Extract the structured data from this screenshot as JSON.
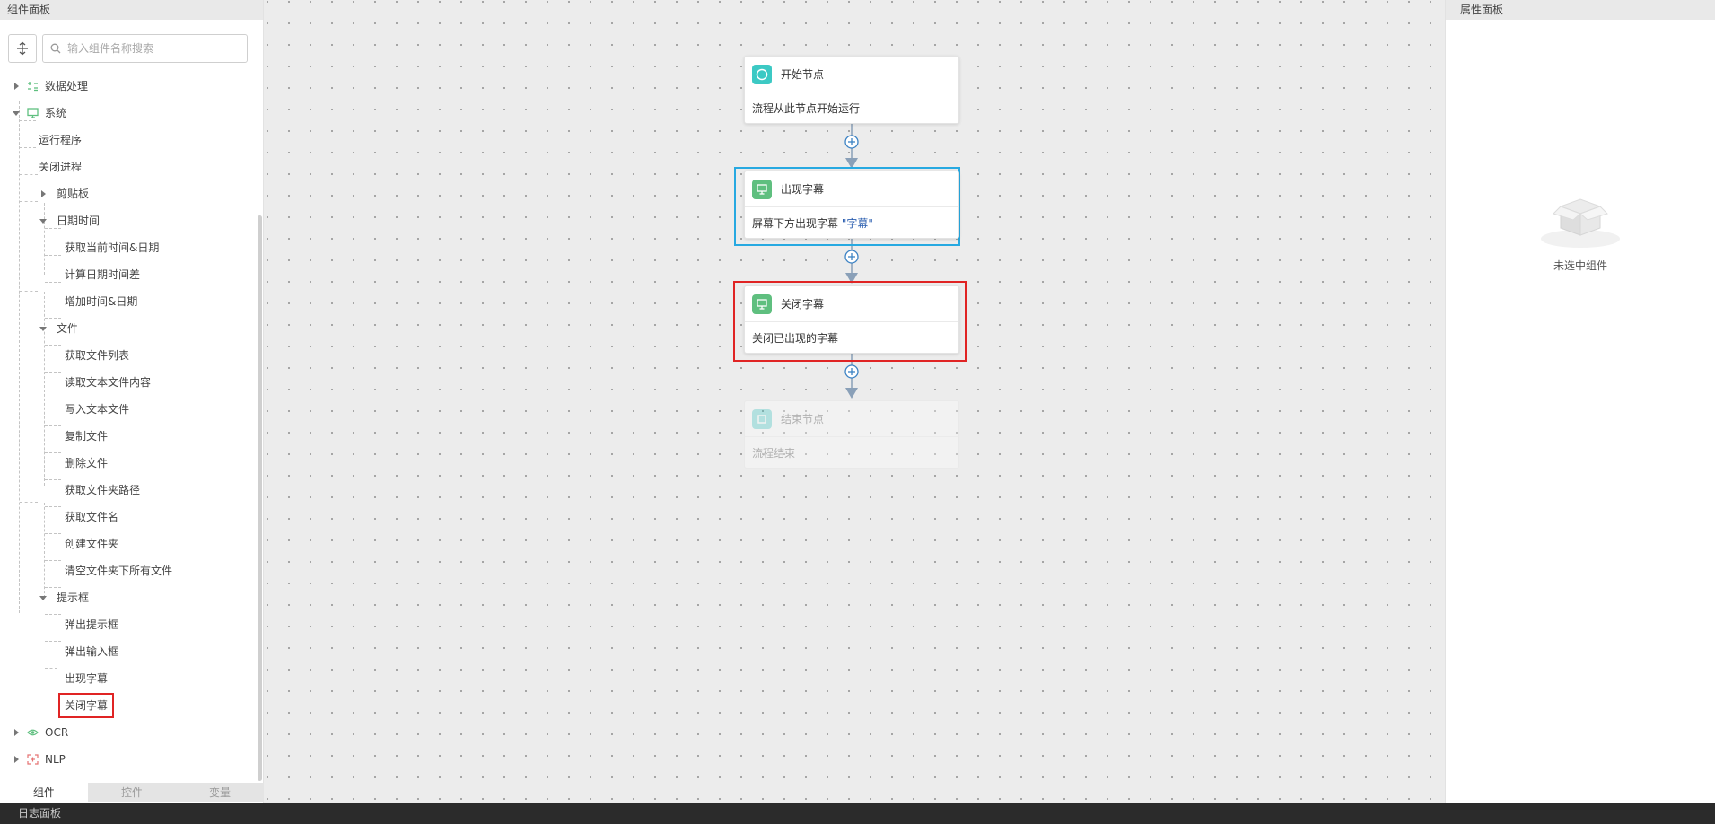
{
  "left_panel": {
    "title": "组件面板",
    "search_placeholder": "输入组件名称搜索",
    "tree": {
      "data_processing": "数据处理",
      "system": "系统",
      "run_program": "运行程序",
      "close_process": "关闭进程",
      "clipboard": "剪贴板",
      "datetime": "日期时间",
      "get_current_datetime": "获取当前时间&日期",
      "calc_date_diff": "计算日期时间差",
      "add_datetime": "增加时间&日期",
      "file": "文件",
      "get_file_list": "获取文件列表",
      "read_text_file": "读取文本文件内容",
      "write_text_file": "写入文本文件",
      "copy_file": "复制文件",
      "delete_file": "删除文件",
      "get_folder_path": "获取文件夹路径",
      "get_file_name": "获取文件名",
      "create_folder": "创建文件夹",
      "clear_folder": "清空文件夹下所有文件",
      "dialog": "提示框",
      "popup_message": "弹出提示框",
      "popup_input": "弹出输入框",
      "show_subtitle": "出现字幕",
      "close_subtitle": "关闭字幕",
      "ocr": "OCR",
      "nlp": "NLP"
    },
    "tabs": [
      "组件",
      "控件",
      "变量"
    ]
  },
  "canvas": {
    "nodes": {
      "start": {
        "title": "开始节点",
        "desc": "流程从此节点开始运行"
      },
      "show_subtitle": {
        "title": "出现字幕",
        "desc_prefix": "屏幕下方出现字幕 ",
        "desc_keyword": "\"字幕\""
      },
      "close_subtitle": {
        "title": "关闭字幕",
        "desc": "关闭已出现的字幕"
      },
      "end": {
        "title": "结束节点",
        "desc": "流程结束"
      }
    }
  },
  "right_panel": {
    "title": "属性面板",
    "empty_text": "未选中组件"
  },
  "log_panel": {
    "title": "日志面板"
  },
  "colors": {
    "start_icon": "#3cc9c4",
    "action_icon": "#5fbf7f",
    "selected_blue": "#27a9e1",
    "highlight_red": "#e02424",
    "connector": "#8aa0b8",
    "add_button": "#3b82c4"
  }
}
